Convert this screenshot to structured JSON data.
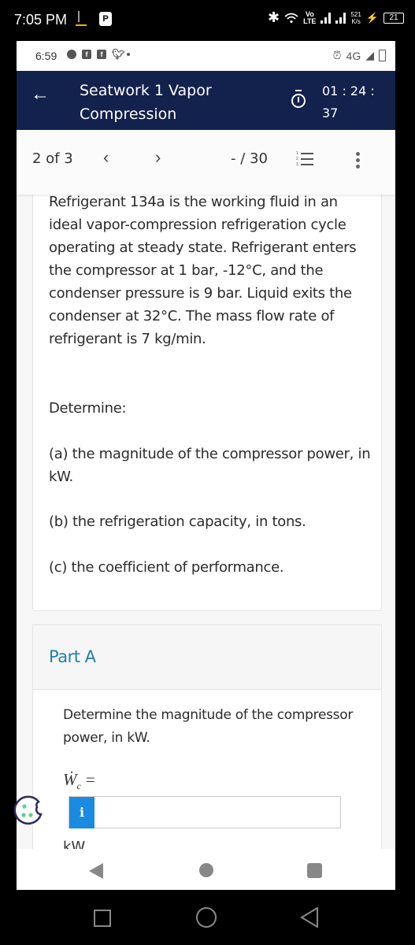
{
  "outer_status": {
    "time": "7:05 PM",
    "network": "Vo LTE",
    "speed_value": "521",
    "speed_unit": "K/s",
    "battery": "21"
  },
  "inner_status": {
    "time": "6:59",
    "network": "4G"
  },
  "header": {
    "title_line1": "Seatwork 1 Vapor",
    "title_line2": "Compression",
    "timer_line1": "01 : 24 :",
    "timer_line2": "37"
  },
  "toolbar": {
    "pager": "2 of 3",
    "prev_label": "‹",
    "next_label": "›",
    "score": "- / 30"
  },
  "problem": {
    "intro": "Refrigerant 134a is the working fluid in an ideal vapor-compression refrigeration cycle operating at steady state. Refrigerant enters the compressor at 1 bar, -12°C, and the condenser pressure is 9 bar. Liquid exits the condenser at 32°C. The mass flow rate of refrigerant is 7 kg/min.",
    "determine": "Determine:",
    "items": [
      "(a) the magnitude of the compressor power, in kW.",
      "(b) the refrigeration capacity, in tons.",
      "(c) the coefficient of performance."
    ]
  },
  "part_a": {
    "label": "Part A",
    "prompt": "Determine the magnitude of the compressor power, in kW.",
    "variable": "Ẇ",
    "subscript": "c",
    "equals": "=",
    "info_label": "i",
    "answer_value": "",
    "answer_placeholder": "",
    "unit": "kW"
  },
  "colors": {
    "header_bg": "#13214d",
    "accent_blue": "#1e7fb0",
    "info_button": "#1a8be0",
    "cookie_outline": "#2d2a5e",
    "cookie_dots": "#5ccf9a"
  }
}
